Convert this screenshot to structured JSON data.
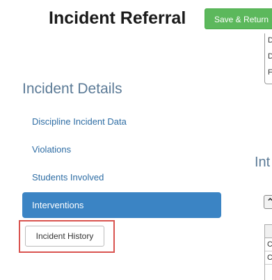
{
  "header": {
    "title": "Incident Referral",
    "save_label": "Save & Return"
  },
  "right_panel_letters": [
    "D",
    "D",
    "F"
  ],
  "sidebar": {
    "heading": "Incident Details",
    "items": [
      {
        "label": "Discipline Incident Data"
      },
      {
        "label": "Violations"
      },
      {
        "label": "Students Involved"
      },
      {
        "label": "Interventions"
      }
    ],
    "history_button": "Incident History"
  },
  "right_section": {
    "heading_fragment": "Int",
    "control_glyph": "⌃",
    "table_rows": [
      "C",
      "C"
    ]
  },
  "colors": {
    "save_button": "#5cb85c",
    "active_nav": "#3b84c4",
    "highlight_box": "#d9534f",
    "heading": "#5b7a96",
    "link": "#2e6da4"
  }
}
